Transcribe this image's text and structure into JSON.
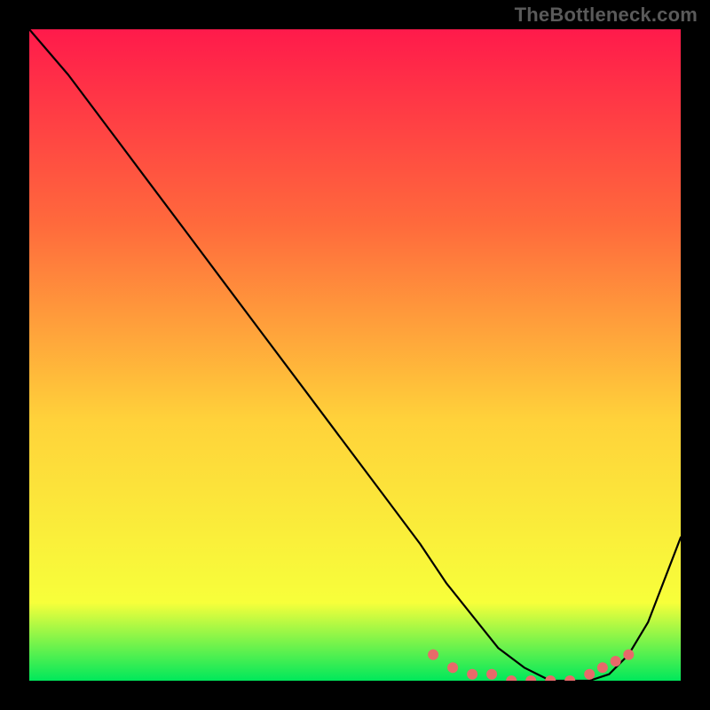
{
  "watermark": "TheBottleneck.com",
  "gradient": {
    "top": "#ff1a4b",
    "upper": "#ff6a3c",
    "mid": "#ffd23a",
    "lower": "#f7ff3a",
    "bottom": "#00e85b"
  },
  "curve": {
    "stroke": "#000000",
    "width": 2.2
  },
  "markers": {
    "fill": "#e76a6a",
    "radius": 6
  },
  "chart_data": {
    "type": "line",
    "title": "",
    "xlabel": "",
    "ylabel": "",
    "xlim": [
      0,
      100
    ],
    "ylim": [
      0,
      100
    ],
    "series": [
      {
        "name": "curve",
        "x": [
          0,
          6,
          12,
          18,
          24,
          30,
          36,
          42,
          48,
          54,
          60,
          64,
          68,
          72,
          76,
          80,
          83,
          86,
          89,
          92,
          95,
          100
        ],
        "values": [
          100,
          93,
          85,
          77,
          69,
          61,
          53,
          45,
          37,
          29,
          21,
          15,
          10,
          5,
          2,
          0,
          0,
          0,
          1,
          4,
          9,
          22
        ]
      }
    ],
    "markers": {
      "name": "highlight-band",
      "x": [
        62,
        65,
        68,
        71,
        74,
        77,
        80,
        83,
        86,
        88,
        90,
        92
      ],
      "values": [
        4,
        2,
        1,
        1,
        0,
        0,
        0,
        0,
        1,
        2,
        3,
        4
      ]
    }
  }
}
